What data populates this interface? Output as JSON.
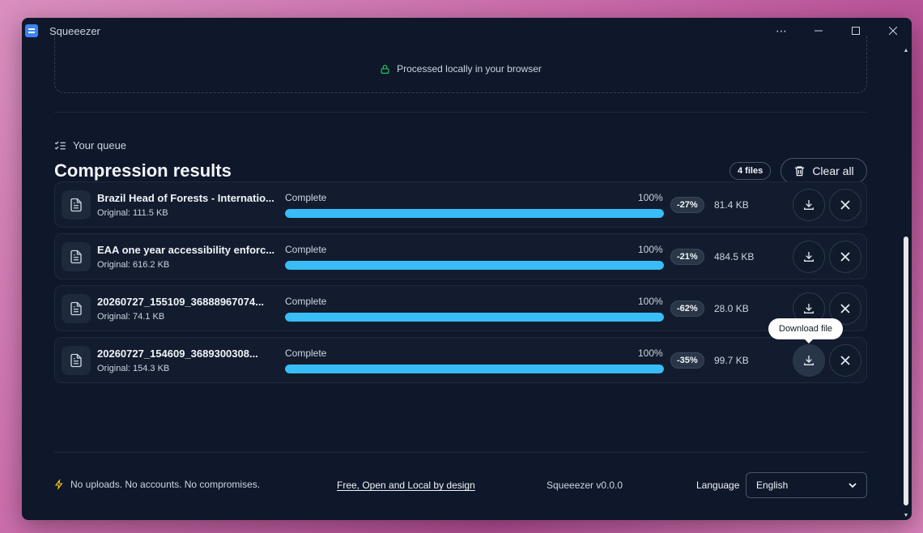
{
  "window": {
    "title": "Squeeezer",
    "controls": {
      "more": "⋯",
      "minimize": "—",
      "maximize": "☐",
      "close": "✕"
    }
  },
  "dropzone": {
    "text": "Processed locally in your browser",
    "icon": "lock-icon"
  },
  "queue": {
    "label": "Your queue",
    "title": "Compression results",
    "file_count": "4 files",
    "clear_all": "Clear all"
  },
  "files": [
    {
      "name": "Brazil Head of Forests - Internatio...",
      "original": "Original: 111.5 KB",
      "status": "Complete",
      "progress_label": "100%",
      "progress": 100,
      "delta": "-27%",
      "size": "81.4 KB"
    },
    {
      "name": "EAA one year accessibility enforc...",
      "original": "Original: 616.2 KB",
      "status": "Complete",
      "progress_label": "100%",
      "progress": 100,
      "delta": "-21%",
      "size": "484.5 KB"
    },
    {
      "name": "20260727_155109_36888967074...",
      "original": "Original: 74.1 KB",
      "status": "Complete",
      "progress_label": "100%",
      "progress": 100,
      "delta": "-62%",
      "size": "28.0 KB"
    },
    {
      "name": "20260727_154609_3689300308...",
      "original": "Original: 154.3 KB",
      "status": "Complete",
      "progress_label": "100%",
      "progress": 100,
      "delta": "-35%",
      "size": "99.7 KB"
    }
  ],
  "tooltip": {
    "text": "Download file"
  },
  "footer": {
    "tagline": "No uploads. No accounts. No compromises.",
    "link": "Free, Open and Local by design",
    "version": "Squeeezer v0.0.0",
    "language_label": "Language",
    "language_value": "English"
  },
  "colors": {
    "accent": "#38bdf8",
    "background": "#0f172a",
    "success": "#22c55e",
    "warning": "#facc15"
  }
}
